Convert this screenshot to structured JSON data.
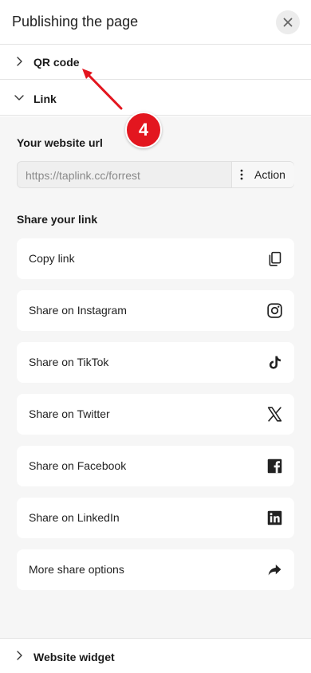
{
  "header": {
    "title": "Publishing the page"
  },
  "sections": {
    "qr_code": {
      "label": "QR code",
      "expanded": false
    },
    "link": {
      "label": "Link",
      "expanded": true
    },
    "website_widget": {
      "label": "Website widget",
      "expanded": false
    }
  },
  "link": {
    "url_label": "Your website url",
    "url_value": "https://taplink.cc/forrest",
    "action_label": "Action",
    "share_label": "Share your link",
    "share_items": [
      {
        "label": "Copy link",
        "icon": "copy-icon"
      },
      {
        "label": "Share on Instagram",
        "icon": "instagram-icon"
      },
      {
        "label": "Share on TikTok",
        "icon": "tiktok-icon"
      },
      {
        "label": "Share on Twitter",
        "icon": "x-twitter-icon"
      },
      {
        "label": "Share on Facebook",
        "icon": "facebook-icon"
      },
      {
        "label": "Share on LinkedIn",
        "icon": "linkedin-icon"
      },
      {
        "label": "More share options",
        "icon": "share-arrow-icon"
      }
    ]
  },
  "annotation": {
    "step_number": "4",
    "color": "#e3161f"
  }
}
